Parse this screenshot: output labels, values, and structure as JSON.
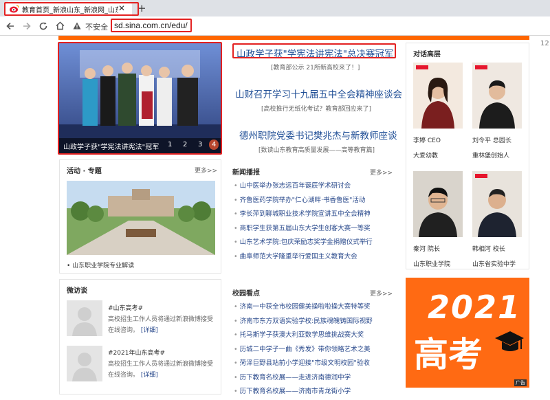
{
  "browser": {
    "tab_title": "教育首页_新浪山东_新浪网_山东",
    "tab_close": "✕",
    "new_tab": "+",
    "security_label": "不安全",
    "url": "sd.sina.com.cn/edu/",
    "side_number": "12"
  },
  "slideshow": {
    "caption": "山政学子获\"学宪法讲宪法\"冠军",
    "pages": [
      "1",
      "2",
      "3",
      "4"
    ],
    "active_page": "4"
  },
  "headlines": [
    {
      "title": "山政学子获\"学宪法讲宪法\"总决赛冠军",
      "sub": "[教育部公示 21所新高校来了！]"
    },
    {
      "title": "山财召开学习十九届五中全会精神座谈会",
      "sub": "[高校推行无纸化考试？教育部回应来了]"
    },
    {
      "title": "德州职院党委书记樊兆杰与新教师座谈",
      "sub": "[数读山东教育高质量发展——高等教育篇]"
    }
  ],
  "dialog": {
    "title": "对话高层",
    "people": [
      {
        "caption1": "李婷  CEO",
        "caption2": "大爱幼教"
      },
      {
        "caption1": "刘令平  总园长",
        "caption2": "重林堡创始人"
      },
      {
        "caption1": "秦河  院长",
        "caption2": "山东职业学院"
      },
      {
        "caption1": "韩相河  校长",
        "caption2": "山东省实验中学"
      }
    ]
  },
  "activities": {
    "title": "活动 · 专题",
    "more": "更多>>",
    "caption": "• 山东职业学院专业解读"
  },
  "news": {
    "title": "新闻播报",
    "more": "更多>>",
    "items": [
      "山中医举办张志远百年诞辰学术研讨会",
      "齐鲁医药学院举办\"仁心湖畔·书香鲁医\"活动",
      "李长萍到聊城职业技术学院宣讲五中全会精神",
      "商职学生获第五届山东大学生创客大赛一等奖",
      "山东艺术学院:包庆荣励志奖学金捐赠仪式举行",
      "曲阜师范大学隆重举行爱国主义教育大会"
    ]
  },
  "weibo": {
    "title": "微访谈",
    "items": [
      {
        "tag": "#山东高考#",
        "text": "高校招生工作人员将通过新浪微博接受在线咨询。",
        "link": "[详细]"
      },
      {
        "tag": "#2021年山东高考#",
        "text": "高校招生工作人员将通过新浪微博接受在线咨询。",
        "link": "[详细]"
      }
    ]
  },
  "campus": {
    "title": "校园看点",
    "more": "更多>>",
    "items": [
      "济南一中获全市校园健美操啦啦操大赛特等奖",
      "济南市东方双语实验学校:民族魂魄铸国际视野",
      "托马斯学子获澳大利亚数学思维挑战赛大奖",
      "历城二中学子一曲《秀发》带你领略艺术之美",
      "菏泽巨野县站前小学迎接\"市级文明校园\"验收",
      "历下教育名校展——走进济南德润中学",
      "历下教育名校展——济南市青龙街小学"
    ]
  },
  "ad": {
    "year": "2021",
    "word": "高考",
    "badge": "广告"
  },
  "colors": {
    "accent_orange": "#ff6600",
    "link_blue": "#1f4e96",
    "highlight_red": "#e32121"
  }
}
